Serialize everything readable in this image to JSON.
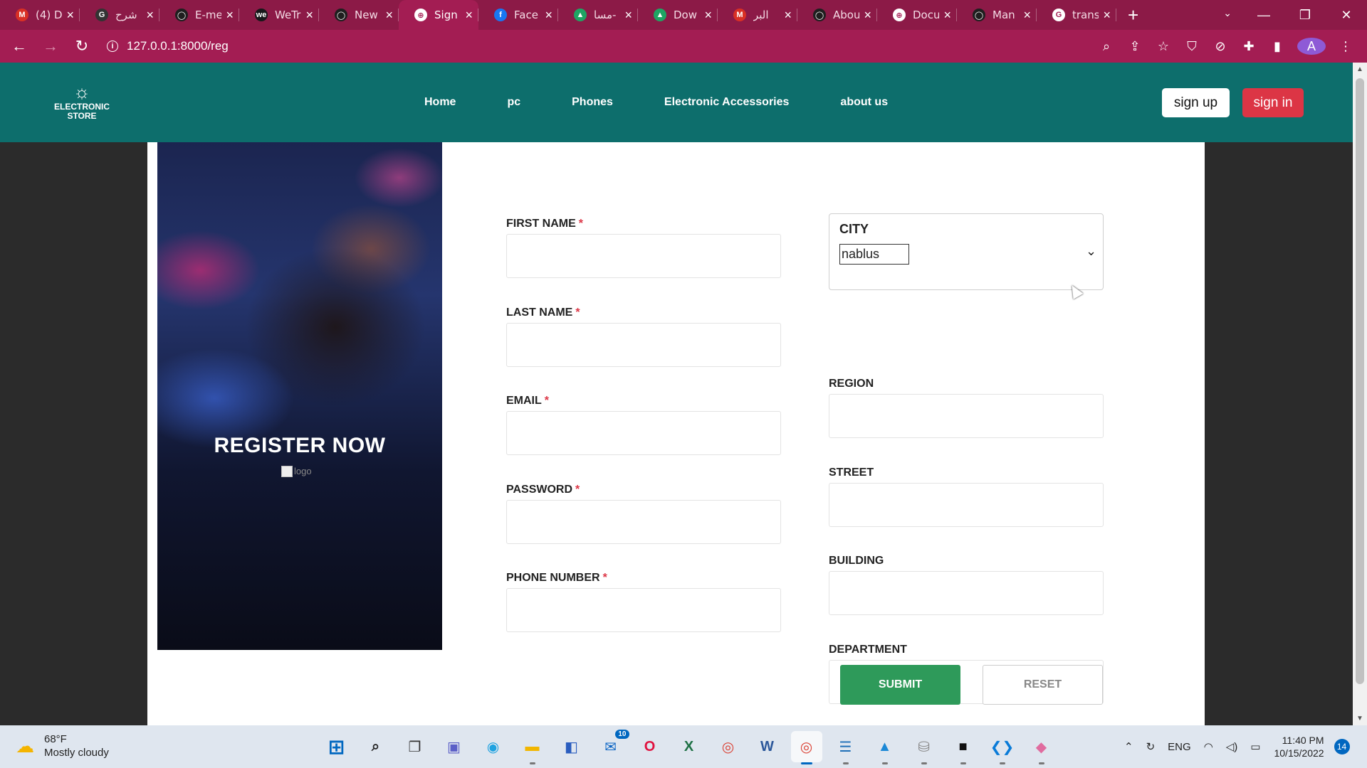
{
  "browser": {
    "tabs": [
      {
        "title": "(4) D",
        "favicon": "gmail-icon",
        "color": "#d93025",
        "glyph": "M"
      },
      {
        "title": "شرح",
        "favicon": "gc-icon",
        "color": "#333333",
        "glyph": "G"
      },
      {
        "title": "E-me",
        "favicon": "github-icon",
        "color": "#1f1f1f",
        "glyph": "◯"
      },
      {
        "title": "WeTr",
        "favicon": "wetransfer-icon",
        "color": "#17181a",
        "glyph": "we"
      },
      {
        "title": "New",
        "favicon": "github-icon",
        "color": "#1f1f1f",
        "glyph": "◯"
      },
      {
        "title": "Sign",
        "favicon": "globe-icon",
        "color": "#ffffff",
        "glyph": "⊕"
      },
      {
        "title": "Face",
        "favicon": "facebook-icon",
        "color": "#1877f2",
        "glyph": "f"
      },
      {
        "title": "مسا-",
        "favicon": "drive-icon",
        "color": "#1fa463",
        "glyph": "▲"
      },
      {
        "title": "Dow",
        "favicon": "drive-icon",
        "color": "#1fa463",
        "glyph": "▲"
      },
      {
        "title": "البر",
        "favicon": "gmail-icon",
        "color": "#d93025",
        "glyph": "M"
      },
      {
        "title": "Abou",
        "favicon": "github-icon",
        "color": "#1f1f1f",
        "glyph": "◯"
      },
      {
        "title": "Docu",
        "favicon": "globe-icon",
        "color": "#ffffff",
        "glyph": "⊕"
      },
      {
        "title": "Man",
        "favicon": "github-icon",
        "color": "#1f1f1f",
        "glyph": "◯"
      },
      {
        "title": "trans",
        "favicon": "google-icon",
        "color": "#ffffff",
        "glyph": "G"
      }
    ],
    "active_tab": 5,
    "url": "127.0.0.1:8000/reg",
    "profile_initial": "A"
  },
  "site": {
    "logo_line1": "ELECTRONIC",
    "logo_line2": "STORE",
    "nav": [
      "Home",
      "pc",
      "Phones",
      "Electronic Accessories",
      "about us"
    ],
    "signup_label": "sign up",
    "signin_label": "sign in"
  },
  "hero": {
    "title": "REGISTER NOW",
    "img_alt": "logo"
  },
  "form": {
    "left_fields": [
      {
        "label": "FIRST NAME",
        "required": "*"
      },
      {
        "label": "LAST NAME",
        "required": "*"
      },
      {
        "label": "EMAIL",
        "required": "*"
      },
      {
        "label": "PASSWORD",
        "required": "*"
      },
      {
        "label": "PHONE NUMBER",
        "required": "*"
      }
    ],
    "city": {
      "label": "CITY",
      "value": "nablus"
    },
    "right_fields": [
      {
        "label": "REGION"
      },
      {
        "label": "STREET"
      },
      {
        "label": "BUILDING"
      },
      {
        "label": "DEPARTMENT"
      }
    ],
    "submit_label": "SUBMIT",
    "reset_label": "RESET"
  },
  "taskbar": {
    "weather_temp": "68°F",
    "weather_desc": "Mostly cloudy",
    "mail_badge": "10",
    "lang": "ENG",
    "time": "11:40 PM",
    "date": "10/15/2022",
    "notifications": "14"
  },
  "colors": {
    "tabbar": "#8c1a47",
    "addressbar": "#a31d53",
    "header": "#0d6e6c",
    "signin": "#dc3545",
    "submit": "#2e9a5a"
  }
}
